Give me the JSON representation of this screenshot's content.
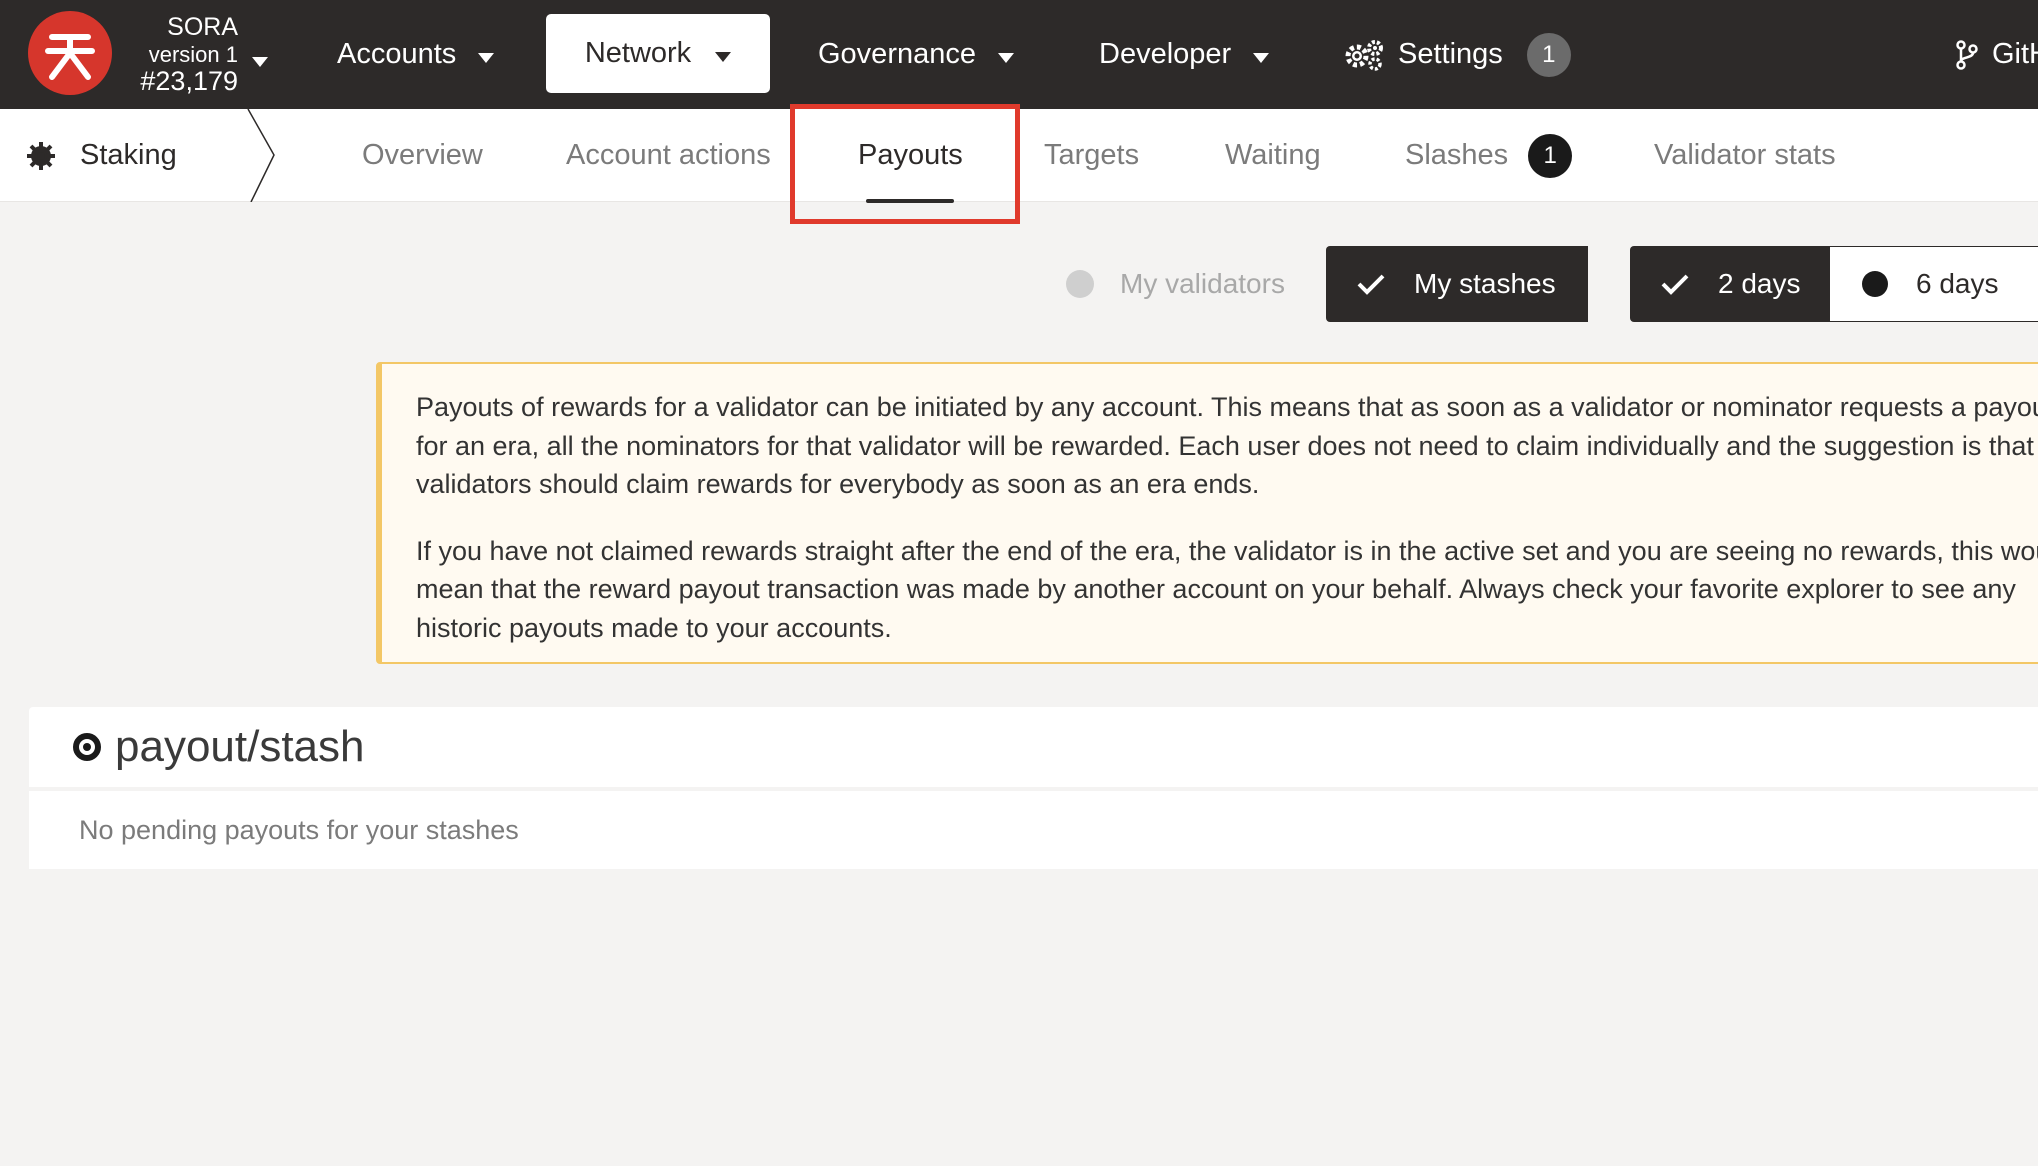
{
  "topbar": {
    "chain": {
      "name": "SORA",
      "version": "version 1",
      "block": "#23,179"
    },
    "nav": {
      "accounts": "Accounts",
      "network": "Network",
      "governance": "Governance",
      "developer": "Developer",
      "settings": "Settings",
      "settings_badge": "1",
      "github": "GitHub"
    }
  },
  "subnav": {
    "section": "Staking",
    "tabs": {
      "overview": "Overview",
      "account_actions": "Account actions",
      "payouts": "Payouts",
      "targets": "Targets",
      "waiting": "Waiting",
      "slashes": "Slashes",
      "slashes_badge": "1",
      "validator_stats": "Validator stats"
    },
    "active_tab": "Payouts"
  },
  "filters": {
    "my_validators": "My validators",
    "my_stashes": "My stashes",
    "two_days": "2 days",
    "six_days": "6 days"
  },
  "info": {
    "paragraph1": "Payouts of rewards for a validator can be initiated by any account. This means that as soon as a validator or nominator requests a payout for an era, all the nominators for that validator will be rewarded. Each user does not need to claim individually and the suggestion is that validators should claim rewards for everybody as soon as an era ends.",
    "paragraph2": "If you have not claimed rewards straight after the end of the era, the validator is in the active set and you are seeing no rewards, this would mean that the reward payout transaction was made by another account on your behalf. Always check your favorite explorer to see any historic payouts made to your accounts."
  },
  "payouts": {
    "title": "payout/stash",
    "empty_message": "No pending payouts for your stashes"
  },
  "colors": {
    "topbar_bg": "#2d2a29",
    "logo_red": "#d6362c",
    "highlight_red": "#e03a2c",
    "info_border": "#f3c766",
    "info_bg": "#fffaf1",
    "page_bg": "#f4f3f2"
  }
}
